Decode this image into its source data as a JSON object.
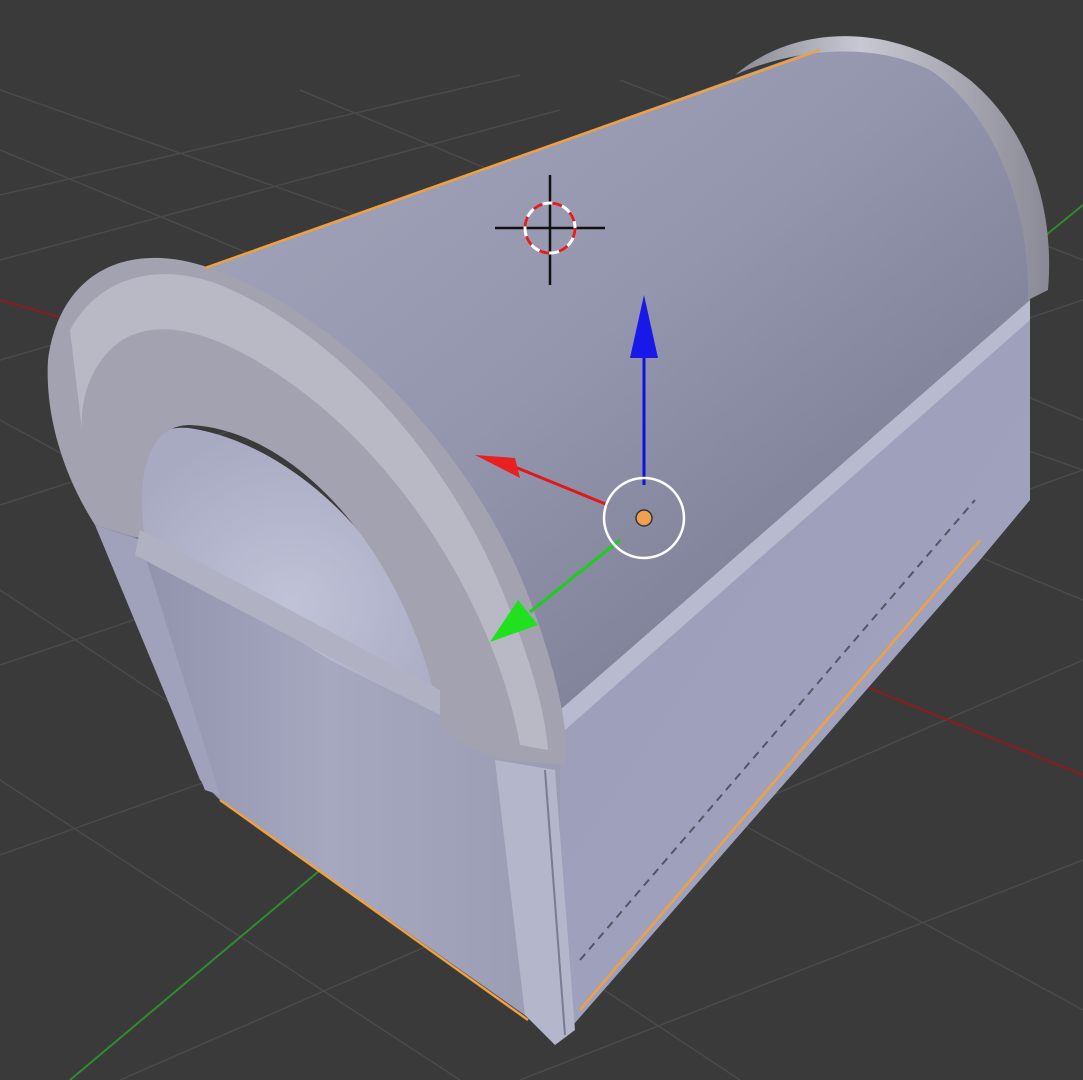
{
  "viewport": {
    "mode": "3d-viewport",
    "background_color": "#3a3a3a",
    "grid_color": "#4a4a4a",
    "axis_x_color": "#8c1c1c",
    "axis_y_color": "#2e8c2e"
  },
  "scene": {
    "object": "treasure-chest-mesh",
    "object_color": "#a8aac0",
    "selection_outline_color": "#f0a040",
    "selected": true
  },
  "cursor_3d": {
    "icon": "3d-cursor-icon",
    "ring_colors": [
      "#e02020",
      "#ffffff"
    ]
  },
  "gizmo": {
    "type": "translate",
    "x_axis_color": "#e01818",
    "y_axis_color": "#18d018",
    "z_axis_color": "#1010e0",
    "origin_color": "#f0a050"
  }
}
